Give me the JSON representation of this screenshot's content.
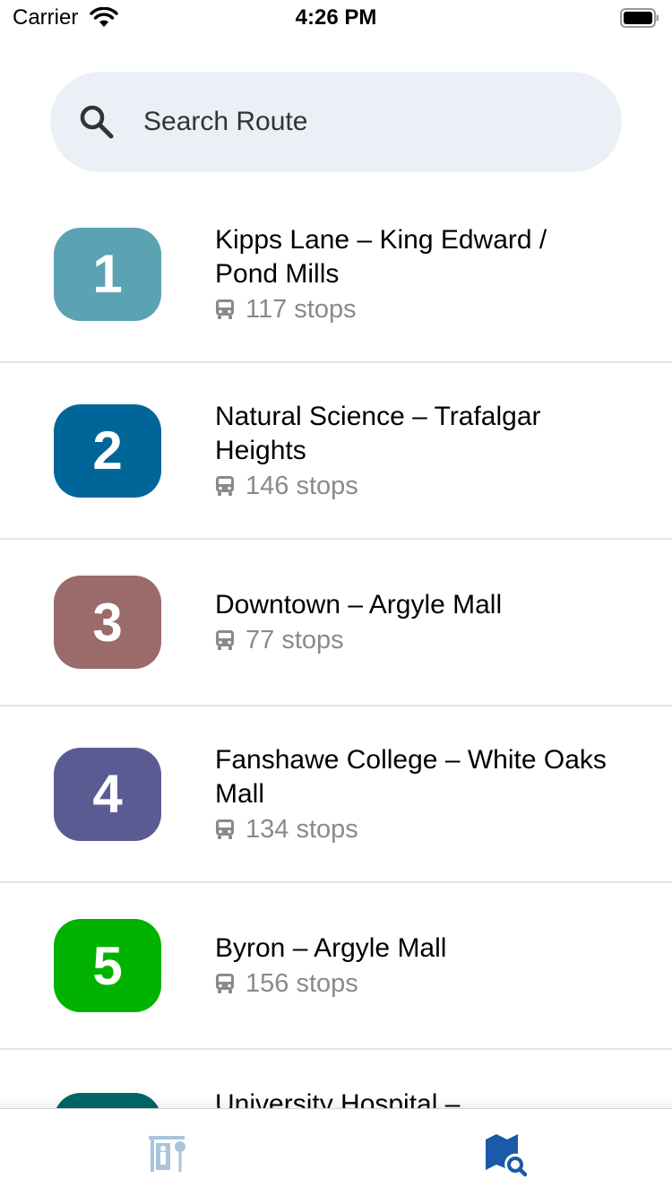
{
  "status_bar": {
    "carrier": "Carrier",
    "time": "4:26 PM",
    "icons": [
      "wifi-icon",
      "battery-icon"
    ]
  },
  "search": {
    "placeholder": "Search Route",
    "icon": "search-icon"
  },
  "routes": [
    {
      "number": "1",
      "name": "Kipps Lane – King Edward / Pond Mills",
      "stops": "117 stops",
      "color": "#5ba2b3"
    },
    {
      "number": "2",
      "name": "Natural Science – Trafalgar Heights",
      "stops": "146 stops",
      "color": "#006699"
    },
    {
      "number": "3",
      "name": "Downtown – Argyle Mall",
      "stops": "77 stops",
      "color": "#9b6a6a"
    },
    {
      "number": "4",
      "name": "Fanshawe College – White Oaks Mall",
      "stops": "134 stops",
      "color": "#5b5b94"
    },
    {
      "number": "5",
      "name": "Byron – Argyle Mall",
      "stops": "156 stops",
      "color": "#00b300"
    },
    {
      "number": "",
      "name": "University Hospital –",
      "stops": "",
      "color": "#006666"
    }
  ],
  "tab_bar": {
    "tabs": [
      {
        "icon": "bus-stop-icon",
        "color": "#a9c4dc",
        "active": false
      },
      {
        "icon": "map-search-icon",
        "color": "#1a5aa8",
        "active": true
      }
    ]
  }
}
